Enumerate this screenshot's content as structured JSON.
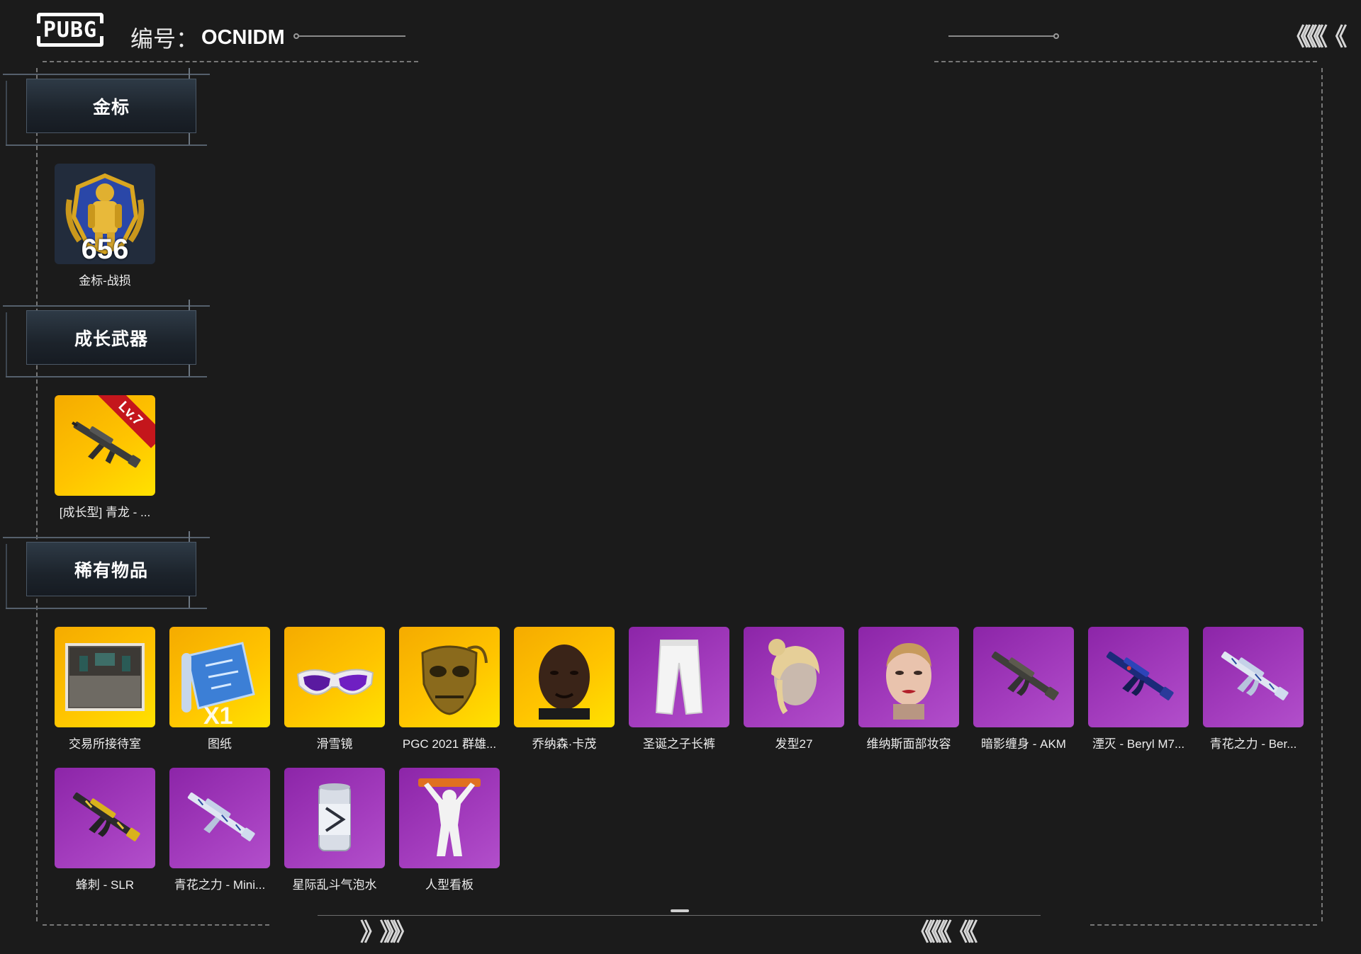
{
  "header": {
    "logo_text": "PUBG",
    "id_label": "编号：",
    "id_value": "OCNIDM",
    "chevrons_top_right": "《《《《 《"
  },
  "footer": {
    "chevrons_left": "》 》》》",
    "chevrons_right": "《《《《 《《"
  },
  "sections": [
    {
      "title": "金标",
      "items": [
        {
          "name": "金标-战损",
          "bg": "navy",
          "icon": "gold-badge-icon",
          "badge": "656"
        }
      ]
    },
    {
      "title": "成长武器",
      "items": [
        {
          "name": "[成长型] 青龙 - ...",
          "bg": "gold",
          "icon": "rifle-icon",
          "level": "Lv.7"
        }
      ]
    },
    {
      "title": "稀有物品",
      "items": [
        {
          "name": "交易所接待室",
          "bg": "gold",
          "icon": "room-icon"
        },
        {
          "name": "图纸",
          "bg": "gold",
          "icon": "blueprint-icon",
          "qty": "X1"
        },
        {
          "name": "滑雪镜",
          "bg": "gold",
          "icon": "goggles-icon"
        },
        {
          "name": "PGC 2021 群雄...",
          "bg": "gold",
          "icon": "mask-icon"
        },
        {
          "name": "乔纳森·卡茂",
          "bg": "gold",
          "icon": "face-icon"
        },
        {
          "name": "圣诞之子长裤",
          "bg": "purple",
          "icon": "pants-icon"
        },
        {
          "name": "发型27",
          "bg": "purple",
          "icon": "hair-icon"
        },
        {
          "name": "维纳斯面部妆容",
          "bg": "purple",
          "icon": "face-makeup-icon"
        },
        {
          "name": "暗影缠身 - AKM",
          "bg": "purple",
          "icon": "rifle-icon"
        },
        {
          "name": "湮灭 - Beryl M7...",
          "bg": "purple",
          "icon": "rifle-icon"
        },
        {
          "name": "青花之力 - Ber...",
          "bg": "purple",
          "icon": "rifle-icon"
        },
        {
          "name": "蜂刺 - SLR",
          "bg": "purple",
          "icon": "rifle-icon"
        },
        {
          "name": "青花之力 - Mini...",
          "bg": "purple",
          "icon": "rifle-icon"
        },
        {
          "name": "星际乱斗气泡水",
          "bg": "purple",
          "icon": "soda-can-icon"
        },
        {
          "name": "人型看板",
          "bg": "purple",
          "icon": "figure-sign-icon"
        }
      ]
    }
  ],
  "colors": {
    "background": "#1b1b1b",
    "gold_tile": "#ffc400",
    "purple_tile": "#a43dbe",
    "navy_tile": "#222c3c"
  }
}
